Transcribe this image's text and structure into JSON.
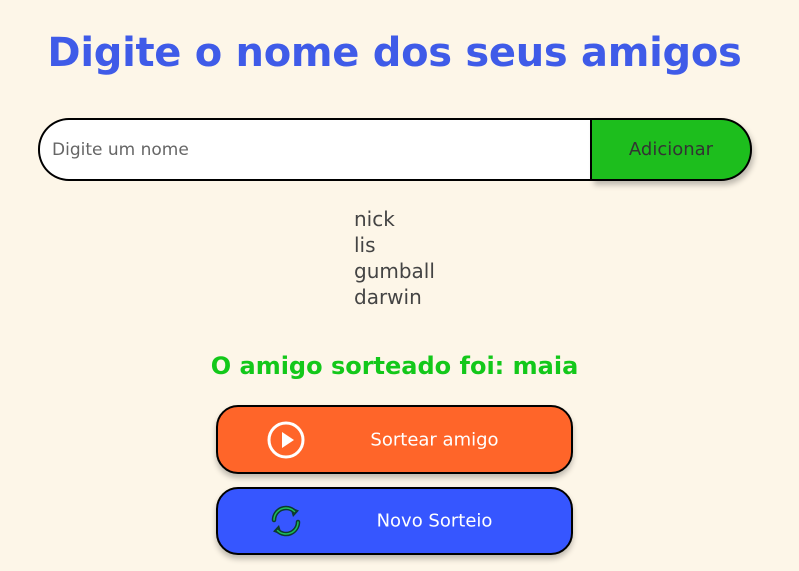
{
  "header": {
    "title": "Digite o nome dos seus amigos"
  },
  "input": {
    "placeholder": "Digite um nome",
    "value": "",
    "add_label": "Adicionar"
  },
  "friends": [
    "nick",
    "lis",
    "gumball",
    "darwin"
  ],
  "result": {
    "text": "O amigo sorteado foi: maia"
  },
  "buttons": {
    "draw_label": "Sortear amigo",
    "draw_icon": "play-circle-icon",
    "reset_label": "Novo Sorteio",
    "reset_icon": "refresh-icon"
  },
  "colors": {
    "background": "#fdf6e8",
    "title": "#3f5be8",
    "add_button": "#1dbe1d",
    "result": "#13c81a",
    "draw_button": "#ff6529",
    "reset_button": "#3656ff"
  }
}
